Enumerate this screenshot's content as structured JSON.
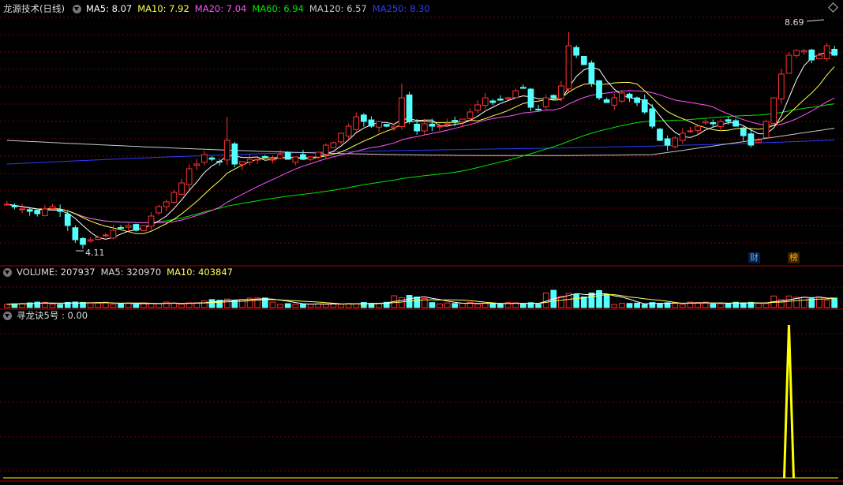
{
  "colors": {
    "up": "#ff3232",
    "down": "#54ffff",
    "grid": "#7a0000",
    "border": "#b00000",
    "ma5": "#ffffff",
    "ma10": "#ffff54",
    "ma20": "#ff54ff",
    "ma60": "#00e600",
    "ma120": "#c8c8c8",
    "ma250": "#2a3cff",
    "signal": "#ffff00"
  },
  "price_header": {
    "title": "龙源技术(日线)",
    "items": [
      {
        "text": "MA5: 8.07",
        "color": "#ffffff"
      },
      {
        "text": "MA10: 7.92",
        "color": "#ffff54"
      },
      {
        "text": "MA20: 7.04",
        "color": "#ff54ff"
      },
      {
        "text": "MA60: 6.94",
        "color": "#00e600"
      },
      {
        "text": "MA120: 6.57",
        "color": "#c8c8c8"
      },
      {
        "text": "MA250: 8.30",
        "color": "#2a3cff"
      }
    ]
  },
  "volume_header": {
    "items": [
      {
        "text": "VOLUME: 207937",
        "color": "#dddddd"
      },
      {
        "text": "MA5: 320970",
        "color": "#dddddd"
      },
      {
        "text": "MA10: 403847",
        "color": "#ffff54"
      }
    ]
  },
  "indicator_header": {
    "items": [
      {
        "text": "寻龙诀5号 : 0.00",
        "color": "#dddddd"
      }
    ]
  },
  "annotations": {
    "high": "8.69",
    "low": "4.11"
  },
  "tags": {
    "cai": "财",
    "bang": "榜"
  },
  "chart_data": {
    "type": "candlestick",
    "price_range": [
      4.0,
      9.0
    ],
    "candles_seed": [
      5.05,
      5.0,
      4.95,
      4.9,
      4.85,
      4.95,
      5.0,
      4.9,
      4.6,
      4.3,
      4.2,
      4.3,
      4.35,
      4.4,
      4.5,
      4.55,
      4.6,
      4.5,
      4.6,
      4.8,
      5.0,
      5.1,
      5.3,
      5.5,
      5.8,
      5.9,
      6.1,
      6.0,
      5.95,
      6.4,
      5.9,
      5.95,
      6.0,
      6.0,
      6.05,
      6.0,
      6.1,
      6.0,
      6.05,
      6.0,
      6.05,
      6.15,
      6.3,
      6.35,
      6.55,
      6.7,
      6.9,
      6.8,
      6.7,
      6.8,
      6.7,
      6.7,
      7.3,
      6.8,
      6.6,
      6.75,
      6.7,
      6.7,
      6.75,
      6.8,
      6.85,
      7.0,
      7.15,
      7.3,
      7.2,
      7.25,
      7.3,
      7.45,
      7.5,
      7.1,
      7.05,
      7.3,
      7.3,
      7.55,
      8.4,
      8.2,
      8.0,
      7.6,
      7.3,
      7.2,
      7.3,
      7.4,
      7.3,
      7.2,
      7.0,
      6.7,
      6.4,
      6.3,
      6.45,
      6.55,
      6.6,
      6.7,
      6.8,
      6.75,
      6.8,
      6.8,
      6.7,
      6.5,
      6.3,
      6.4,
      6.8,
      7.3,
      7.8,
      8.2,
      8.3,
      8.3,
      8.1,
      8.2,
      8.4,
      8.2
    ],
    "volume_range": [
      0,
      1500000
    ],
    "indicator": {
      "name": "寻龙诀5号",
      "value": 0.0,
      "spike_index": 103
    }
  }
}
